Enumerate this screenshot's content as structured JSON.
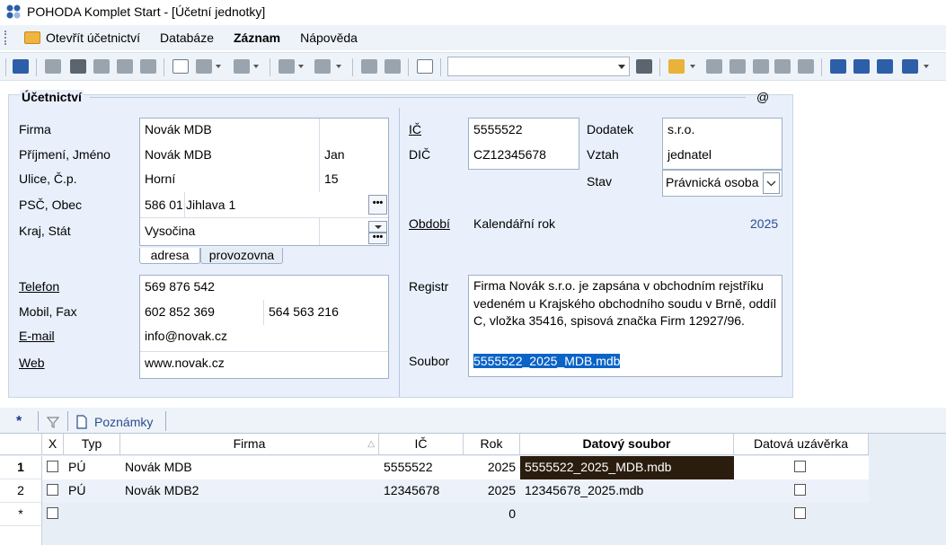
{
  "window": {
    "title": "POHODA Komplet Start - [Účetní jednotky]"
  },
  "menu": {
    "items": [
      "Otevřít účetnictví",
      "Databáze",
      "Záznam",
      "Nápověda"
    ]
  },
  "form": {
    "section_title": "Účetnictví",
    "at_symbol": "@",
    "labels": {
      "firma": "Firma",
      "prijmeni": "Příjmení, Jméno",
      "ulice": "Ulice, Č.p.",
      "psc": "PSČ, Obec",
      "kraj": "Kraj, Stát",
      "telefon": "Telefon",
      "mobil": "Mobil, Fax",
      "email": "E-mail",
      "web": "Web",
      "ic": "IČ",
      "dic": "DIČ",
      "dodatek": "Dodatek",
      "vztah": "Vztah",
      "stav": "Stav",
      "obdobi": "Období",
      "registr": "Registr",
      "soubor": "Soubor"
    },
    "values": {
      "firma": "Novák MDB",
      "prijmeni": "Novák MDB",
      "jmeno": "Jan",
      "ulice": "Horní",
      "cp": "15",
      "psc": "586 01",
      "obec": "Jihlava 1",
      "kraj": "Vysočina",
      "stat": "",
      "telefon": "569 876 542",
      "mobil": "602 852 369",
      "fax": "564 563 216",
      "email": "info@novak.cz",
      "web": "www.novak.cz",
      "ic": "5555522",
      "dic": "CZ12345678",
      "dodatek": "s.r.o.",
      "vztah": "jednatel",
      "stav": "Právnická osoba",
      "obdobi_typ": "Kalendářní rok",
      "obdobi_rok": "2025",
      "registr": "Firma Novák s.r.o. je zapsána v obchodním rejstříku vedeném u Krajského obchodního soudu v Brně, oddíl C, vložka 35416, spisová značka Firm 12927/96.",
      "soubor": "5555522_2025_MDB.mdb"
    },
    "address_tabs": [
      "adresa",
      "provozovna"
    ]
  },
  "bottom_tabs": {
    "star": "*",
    "notes": "Poznámky"
  },
  "grid": {
    "columns": [
      "X",
      "Typ",
      "Firma",
      "IČ",
      "Rok",
      "Datový soubor",
      "Datová uzávěrka"
    ],
    "rows": [
      {
        "num": "1",
        "typ": "PÚ",
        "firma": "Novák MDB",
        "ic": "5555522",
        "rok": "2025",
        "soubor": "5555522_2025_MDB.mdb"
      },
      {
        "num": "2",
        "typ": "PÚ",
        "firma": "Novák MDB2",
        "ic": "12345678",
        "rok": "2025",
        "soubor": "12345678_2025.mdb"
      }
    ],
    "new_row": {
      "marker": "*",
      "rok": "0"
    }
  },
  "colors": {
    "accent": "#2a4d8f",
    "selection": "#0a63c6",
    "current_cell": "#2b1d0e",
    "panel": "#e9f0fb"
  }
}
